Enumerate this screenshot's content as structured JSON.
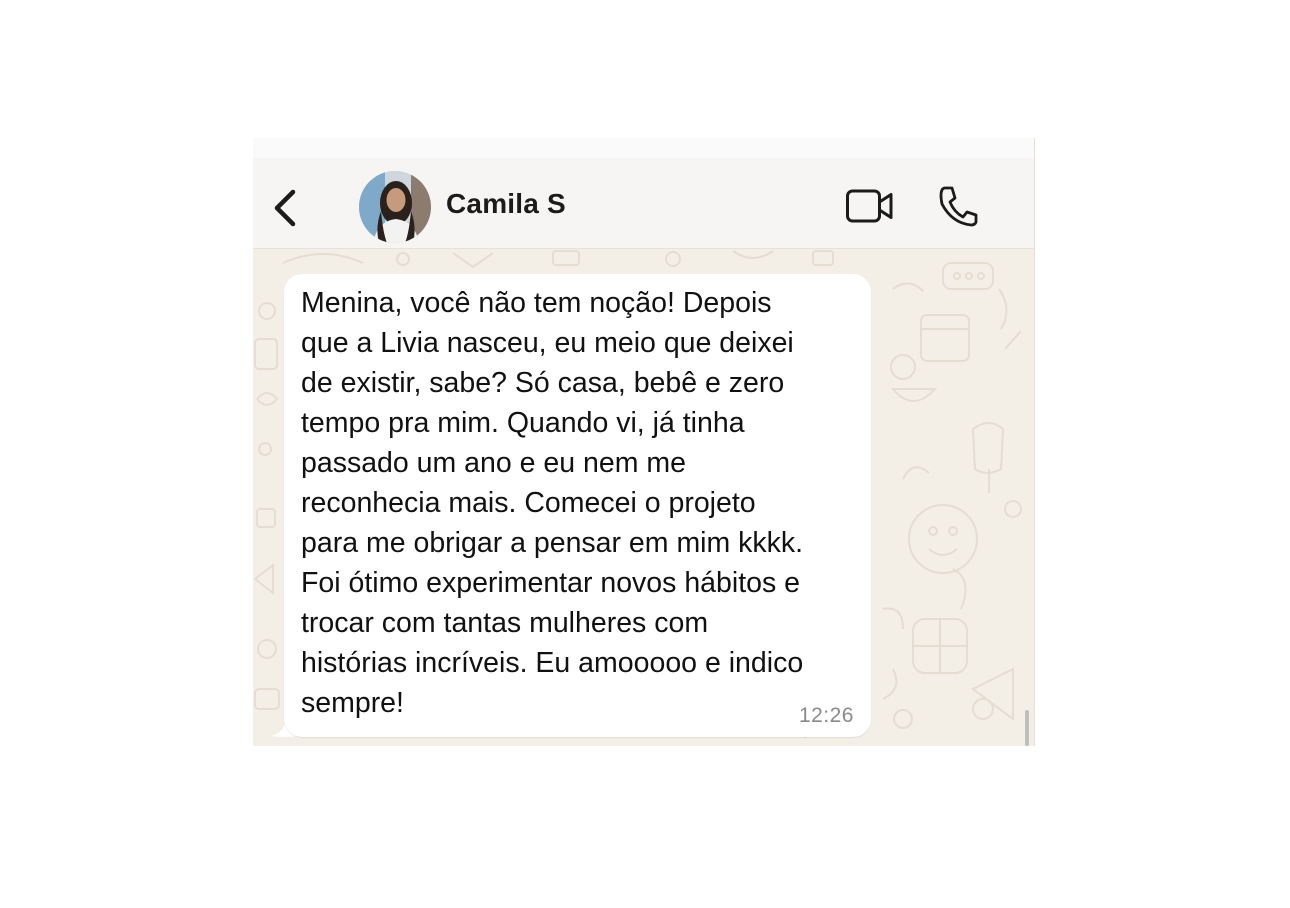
{
  "header": {
    "contact_name": "Camila S",
    "back_icon": "chevron-left-icon",
    "video_icon": "video-camera-icon",
    "call_icon": "phone-icon"
  },
  "message": {
    "text": "Menina, você não tem noção! Depois\nque a Livia nasceu, eu meio que deixei\nde existir, sabe? Só casa, bebê e zero\ntempo pra mim. Quando vi, já tinha\npassado um ano e eu nem me\nreconhecia mais. Comecei o projeto\npara me obrigar a pensar em mim kkkk.\nFoi ótimo experimentar novos hábitos e\ntrocar com tantas mulheres com\nhistórias incríveis. Eu amooooo e indico\nsempre!",
    "time": "12:26"
  },
  "colors": {
    "wallpaper": "#f3efe7",
    "bubble": "#ffffff",
    "header": "#f6f5f3",
    "text": "#111111",
    "time": "#8a8a8a"
  }
}
